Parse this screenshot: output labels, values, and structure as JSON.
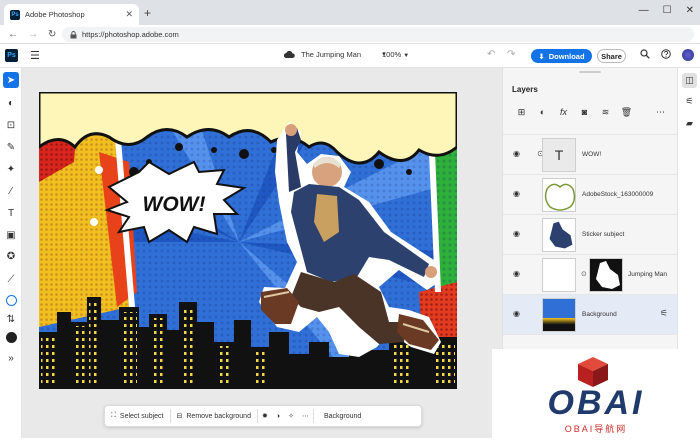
{
  "browser": {
    "tab_title": "Adobe Photoshop",
    "url": "https://photoshop.adobe.com",
    "favicon_text": "Ps"
  },
  "app": {
    "logo_text": "Ps",
    "doc_title": "The Jumping Man",
    "zoom": "100%",
    "download_label": "Download",
    "share_label": "Share"
  },
  "canvas": {
    "wow_text": "WOW!"
  },
  "context_bar": {
    "select_subject": "Select subject",
    "remove_background": "Remove background",
    "background": "Background"
  },
  "layers_panel": {
    "title": "Layers",
    "layers": [
      {
        "name": "WOW!",
        "thumb": "T"
      },
      {
        "name": "AdobeStock_163000009"
      },
      {
        "name": "Sticker subject"
      },
      {
        "name": "Jumping Man"
      },
      {
        "name": "Background"
      }
    ]
  },
  "watermark": {
    "big": "OBAI",
    "small": "OBAI导航网"
  },
  "colors": {
    "accent": "#1473e6",
    "ps_dark": "#001e36",
    "ps_blue": "#31a8ff",
    "watermark_red": "#d12a2a",
    "watermark_navy": "#1f3a6b"
  }
}
